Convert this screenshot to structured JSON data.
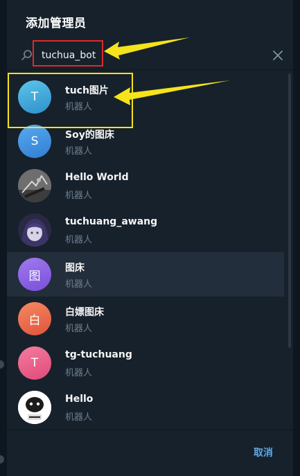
{
  "dialog": {
    "title": "添加管理员",
    "search": {
      "value": "tuchua_bot",
      "placeholder": ""
    },
    "cancel_label": "取消"
  },
  "results": [
    {
      "name": "tuch图片",
      "status": "机器人",
      "avatar_text": "T",
      "avatar_color": "#3ea0d8"
    },
    {
      "name": "Soy的图床",
      "status": "机器人",
      "avatar_text": "S",
      "avatar_color": "#3e8fe0"
    },
    {
      "name": "Hello World",
      "status": "机器人",
      "avatar_text": "",
      "avatar_color": "#444444"
    },
    {
      "name": "tuchuang_awang",
      "status": "机器人",
      "avatar_text": "",
      "avatar_color": "#2c2a46"
    },
    {
      "name": "图床",
      "status": "机器人",
      "avatar_text": "图",
      "avatar_color": "#8b62e6"
    },
    {
      "name": "白嫖图床",
      "status": "机器人",
      "avatar_text": "白",
      "avatar_color": "#ef6a4a"
    },
    {
      "name": "tg-tuchuang",
      "status": "机器人",
      "avatar_text": "T",
      "avatar_color": "#ec5b87"
    },
    {
      "name": "Hello",
      "status": "机器人",
      "avatar_text": "",
      "avatar_color": "#ffffff"
    }
  ],
  "annotations": {
    "highlight_colors": {
      "search": "#e12a2a",
      "result": "#f5e31b",
      "arrow": "#f5e31b"
    }
  },
  "icons": [
    "search-icon",
    "close-icon"
  ]
}
